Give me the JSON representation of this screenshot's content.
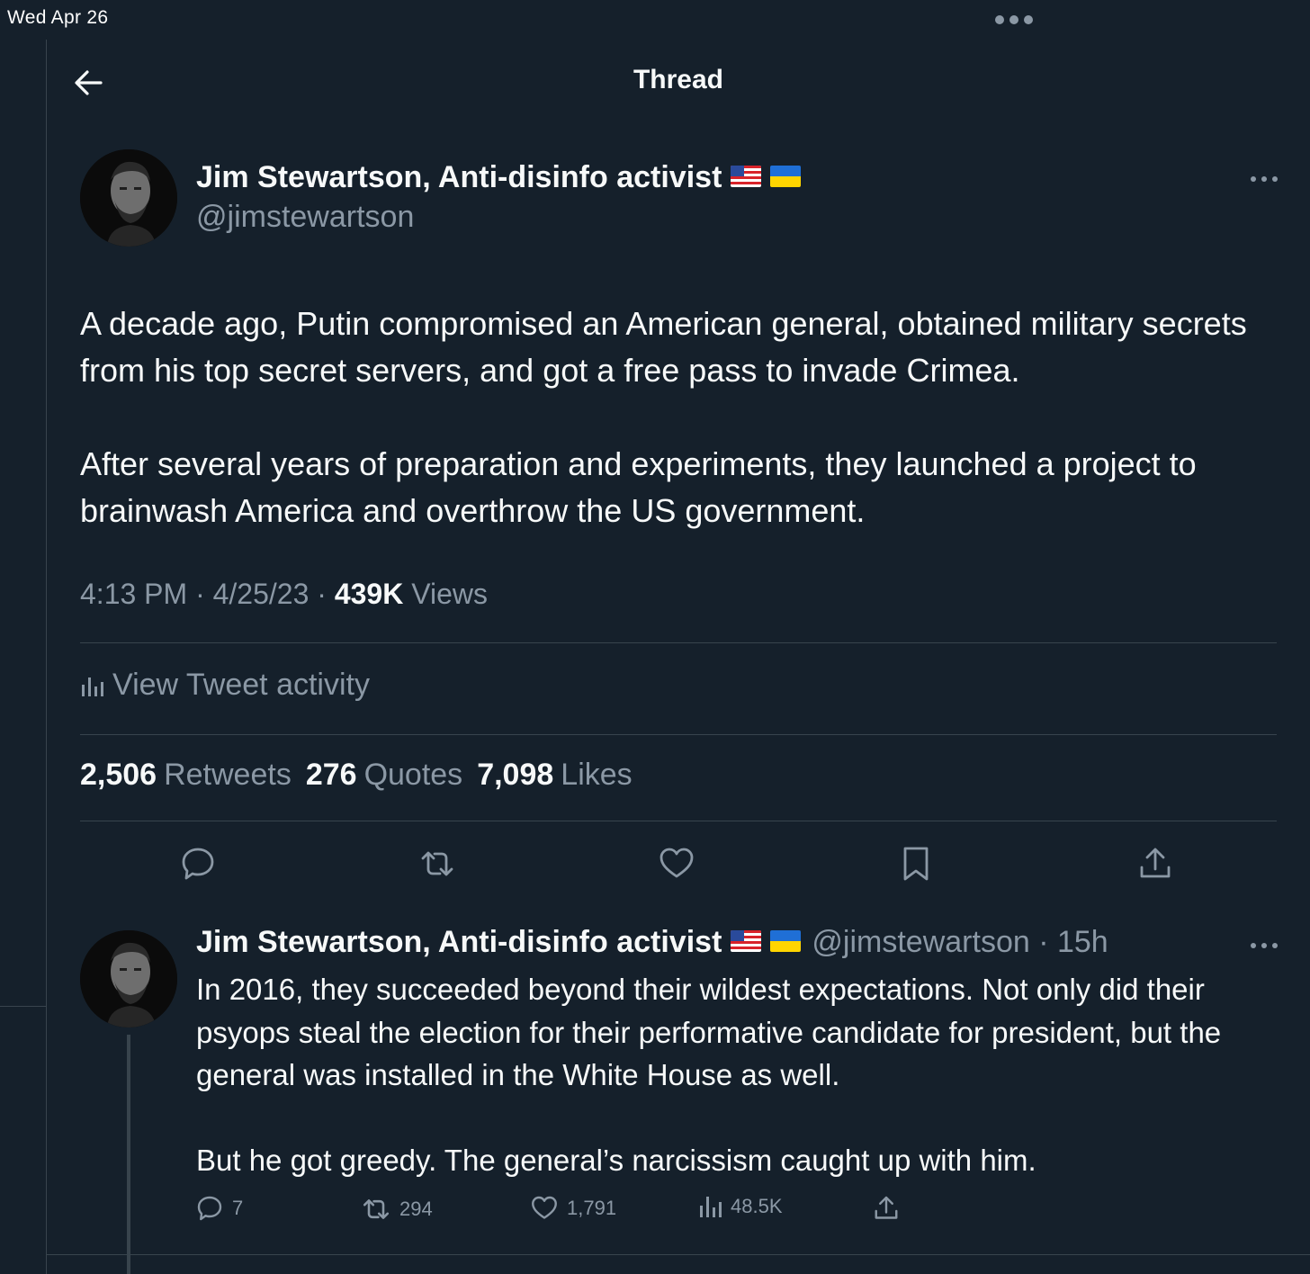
{
  "status_bar": {
    "time": "Wed Apr 26"
  },
  "header": {
    "title": "Thread"
  },
  "main_tweet": {
    "display_name": "Jim Stewartson, Anti-disinfo activist",
    "flags": [
      "us-flag",
      "ukraine-flag"
    ],
    "handle": "@jimstewartson",
    "paragraphs": [
      "A decade ago, Putin compromised an American general, obtained military secrets from his top secret servers, and got a free pass to invade Crimea.",
      "After several years of preparation and experiments, they launched a project to brainwash America and overthrow the US government."
    ],
    "time": "4:13 PM",
    "date": "4/25/23",
    "views_count": "439K",
    "views_label": "Views",
    "activity_label": "View Tweet activity",
    "retweets_count": "2,506",
    "retweets_label": "Retweets",
    "quotes_count": "276",
    "quotes_label": "Quotes",
    "likes_count": "7,098",
    "likes_label": "Likes",
    "actions": [
      "reply-icon",
      "retweet-icon",
      "like-icon",
      "bookmark-icon",
      "share-icon"
    ]
  },
  "reply_tweet": {
    "display_name": "Jim Stewartson, Anti-disinfo activist",
    "handle": "@jimstewartson",
    "age": "15h",
    "paragraphs": [
      "In 2016, they succeeded beyond their wildest expectations. Not only did their psyops steal the election for their performative candidate for president, but the general was installed in the White House as well.",
      "But he got greedy. The general’s narcissism caught up with him."
    ],
    "replies": "7",
    "retweets": "294",
    "likes": "1,791",
    "views": "48.5K"
  },
  "colors": {
    "background": "#15202b",
    "text": "#f7f9f9",
    "secondary": "#8b98a5",
    "border": "#38444d"
  }
}
